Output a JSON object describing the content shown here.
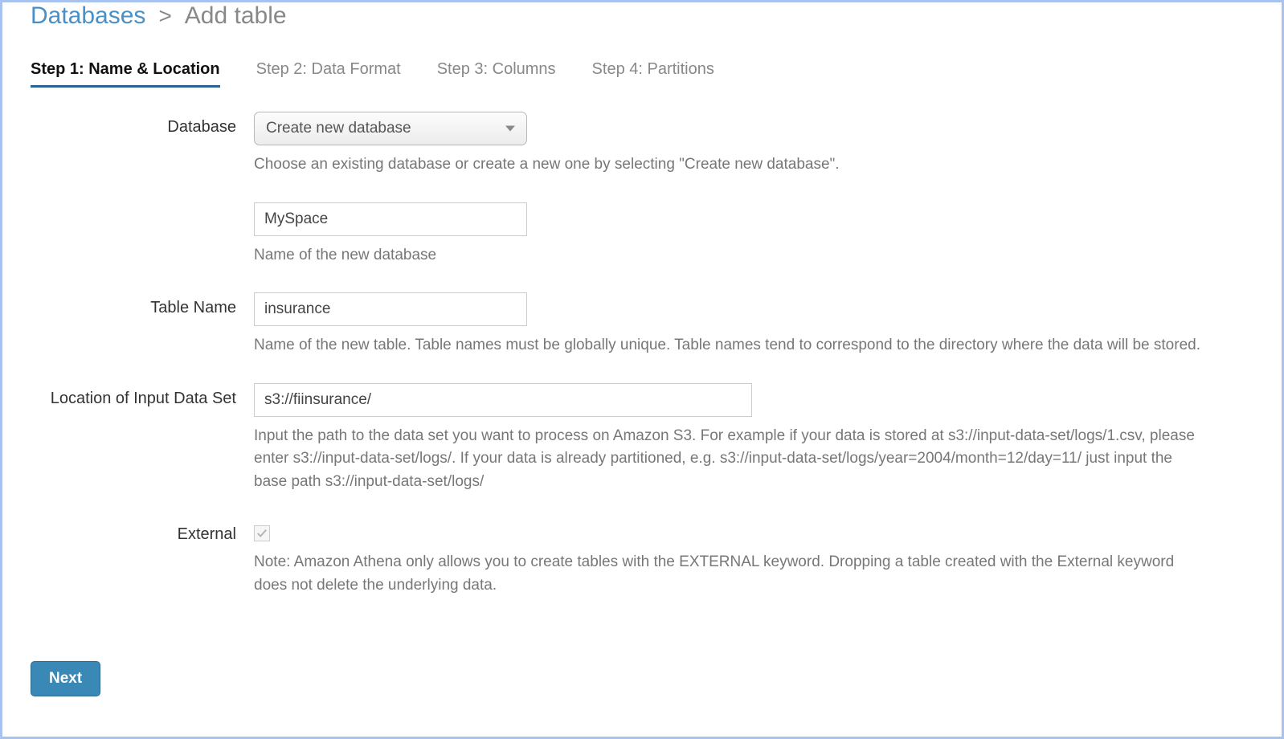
{
  "breadcrumb": {
    "link": "Databases",
    "sep": ">",
    "current": "Add table"
  },
  "tabs": [
    {
      "label": "Step 1: Name & Location",
      "active": true
    },
    {
      "label": "Step 2: Data Format",
      "active": false
    },
    {
      "label": "Step 3: Columns",
      "active": false
    },
    {
      "label": "Step 4: Partitions",
      "active": false
    }
  ],
  "form": {
    "database": {
      "label": "Database",
      "selected": "Create new database",
      "help": "Choose an existing database or create a new one by selecting \"Create new database\".",
      "new_name_value": "MySpace",
      "new_name_help": "Name of the new database"
    },
    "table_name": {
      "label": "Table Name",
      "value": "insurance",
      "help": "Name of the new table. Table names must be globally unique. Table names tend to correspond to the directory where the data will be stored."
    },
    "location": {
      "label": "Location of Input Data Set",
      "value": "s3://fiinsurance/",
      "help": "Input the path to the data set you want to process on Amazon S3. For example if your data is stored at s3://input-data-set/logs/1.csv, please enter s3://input-data-set/logs/. If your data is already partitioned, e.g. s3://input-data-set/logs/year=2004/month=12/day=11/ just input the base path s3://input-data-set/logs/"
    },
    "external": {
      "label": "External",
      "checked": true,
      "help": "Note: Amazon Athena only allows you to create tables with the EXTERNAL keyword. Dropping a table created with the External keyword does not delete the underlying data."
    }
  },
  "next_button": "Next"
}
